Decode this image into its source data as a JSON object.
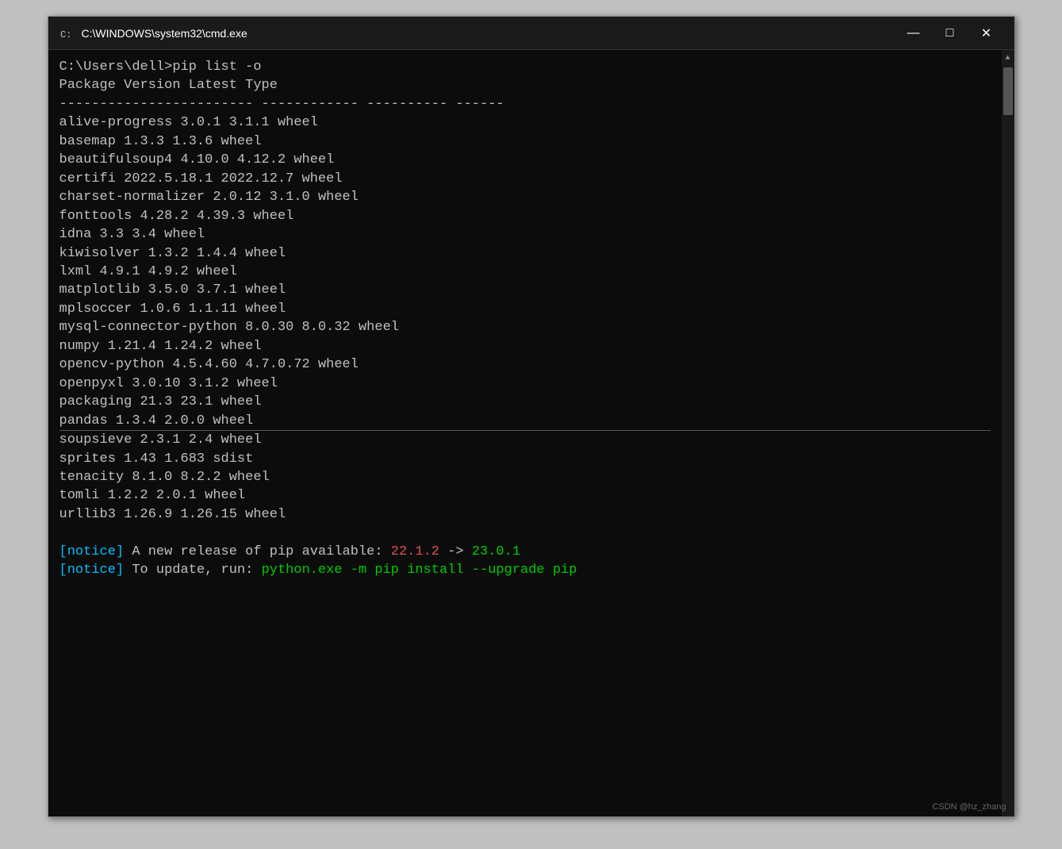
{
  "window": {
    "title": "C:\\WINDOWS\\system32\\cmd.exe",
    "min_label": "—",
    "max_label": "□",
    "close_label": "✕"
  },
  "terminal": {
    "prompt": "C:\\Users\\dell>pip list -o",
    "headers": {
      "package": "Package",
      "version": "Version",
      "latest": "Latest",
      "type": "Type"
    },
    "separator": {
      "pkg": "------------------------",
      "ver": "------------",
      "lat": "----------",
      "typ": "------"
    },
    "packages_white": [
      {
        "name": "alive-progress",
        "version": "3.0.1",
        "latest": "3.1.1",
        "type": "wheel"
      },
      {
        "name": "basemap",
        "version": "1.3.3",
        "latest": "1.3.6",
        "type": "wheel"
      },
      {
        "name": "beautifulsoup4",
        "version": "4.10.0",
        "latest": "4.12.2",
        "type": "wheel"
      },
      {
        "name": "certifi",
        "version": "2022.5.18.1",
        "latest": "2022.12.7",
        "type": "wheel"
      },
      {
        "name": "charset-normalizer",
        "version": "2.0.12",
        "latest": "3.1.0",
        "type": "wheel"
      },
      {
        "name": "fonttools",
        "version": "4.28.2",
        "latest": "4.39.3",
        "type": "wheel"
      },
      {
        "name": "idna",
        "version": "3.3",
        "latest": "3.4",
        "type": "wheel"
      },
      {
        "name": "kiwisolver",
        "version": "1.3.2",
        "latest": "1.4.4",
        "type": "wheel"
      },
      {
        "name": "lxml",
        "version": "4.9.1",
        "latest": "4.9.2",
        "type": "wheel"
      },
      {
        "name": "matplotlib",
        "version": "3.5.0",
        "latest": "3.7.1",
        "type": "wheel"
      },
      {
        "name": "mplsoccer",
        "version": "1.0.6",
        "latest": "1.1.11",
        "type": "wheel"
      },
      {
        "name": "mysql-connector-python",
        "version": "8.0.30",
        "latest": "8.0.32",
        "type": "wheel"
      },
      {
        "name": "numpy",
        "version": "1.21.4",
        "latest": "1.24.2",
        "type": "wheel"
      },
      {
        "name": "opencv-python",
        "version": "4.5.4.60",
        "latest": "4.7.0.72",
        "type": "wheel"
      },
      {
        "name": "openpyxl",
        "version": "3.0.10",
        "latest": "3.1.2",
        "type": "wheel"
      },
      {
        "name": "packaging",
        "version": "21.3",
        "latest": "23.1",
        "type": "wheel"
      },
      {
        "name": "pandas",
        "version": "1.3.4",
        "latest": "2.0.0",
        "type": "wheel"
      }
    ],
    "packages_gray": [
      {
        "name": "soupsieve",
        "version": "2.3.1",
        "latest": "2.4",
        "type": "wheel"
      },
      {
        "name": "sprites",
        "version": "1.43",
        "latest": "1.683",
        "type": "sdist"
      },
      {
        "name": "tenacity",
        "version": "8.1.0",
        "latest": "8.2.2",
        "type": "wheel"
      },
      {
        "name": "tomli",
        "version": "1.2.2",
        "latest": "2.0.1",
        "type": "wheel"
      },
      {
        "name": "urllib3",
        "version": "1.26.9",
        "latest": "1.26.15",
        "type": "wheel"
      }
    ],
    "notice1": {
      "label": "[notice]",
      "text": " A new release of pip available: ",
      "old_ver": "22.1.2",
      "arrow": " -> ",
      "new_ver": "23.0.1"
    },
    "notice2": {
      "label": "[notice]",
      "text": " To update, run: ",
      "cmd": "python.exe -m pip install --upgrade pip"
    }
  },
  "watermark": "CSDN @hz_zhang"
}
